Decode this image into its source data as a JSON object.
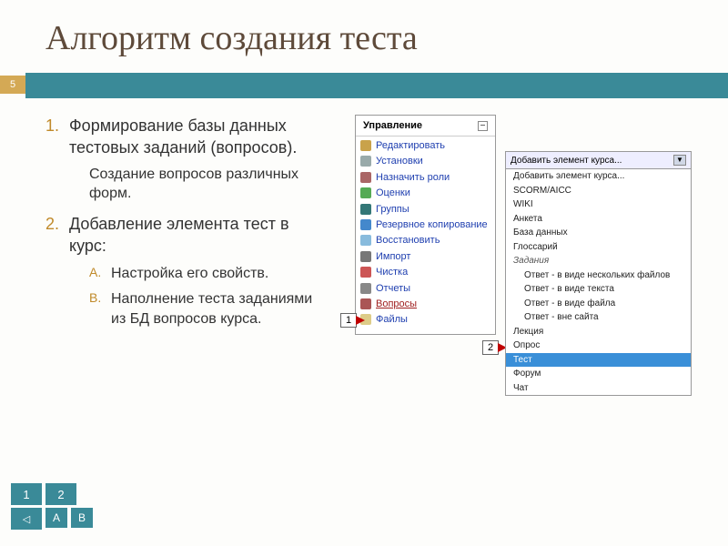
{
  "slide": {
    "title": "Алгоритм создания теста",
    "page_number": "5"
  },
  "outline": {
    "items": [
      {
        "num": "1.",
        "text": "Формирование базы данных тестовых заданий (вопросов).",
        "sub": "Создание вопросов различных форм."
      },
      {
        "num": "2.",
        "text": "Добавление элемента тест в курс:",
        "children": [
          {
            "lit": "A.",
            "text": "Настройка его свойств."
          },
          {
            "lit": "B.",
            "text": "Наполнение теста заданиями из БД вопросов курса."
          }
        ]
      }
    ]
  },
  "admin_panel": {
    "title": "Управление",
    "items": [
      {
        "label": "Редактировать",
        "icon": "#c9a24a"
      },
      {
        "label": "Установки",
        "icon": "#9aa"
      },
      {
        "label": "Назначить роли",
        "icon": "#a66"
      },
      {
        "label": "Оценки",
        "icon": "#5a5"
      },
      {
        "label": "Группы",
        "icon": "#377"
      },
      {
        "label": "Резервное копирование",
        "icon": "#48c"
      },
      {
        "label": "Восстановить",
        "icon": "#8bd"
      },
      {
        "label": "Импорт",
        "icon": "#777"
      },
      {
        "label": "Чистка",
        "icon": "#c55"
      },
      {
        "label": "Отчеты",
        "icon": "#888"
      },
      {
        "label": "Вопросы",
        "icon": "#a55",
        "hl": true
      },
      {
        "label": "Файлы",
        "icon": "#dc8"
      }
    ]
  },
  "dropdown": {
    "header": "Добавить элемент курса...",
    "options": [
      {
        "label": "Добавить элемент курса..."
      },
      {
        "label": "SCORM/AICC"
      },
      {
        "label": "WIKI"
      },
      {
        "label": "Анкета"
      },
      {
        "label": "База данных"
      },
      {
        "label": "Глоссарий"
      },
      {
        "label": "Задания",
        "section": true
      },
      {
        "label": "Ответ - в виде нескольких файлов",
        "indent": true
      },
      {
        "label": "Ответ - в виде текста",
        "indent": true
      },
      {
        "label": "Ответ - в виде файла",
        "indent": true
      },
      {
        "label": "Ответ - вне сайта",
        "indent": true
      },
      {
        "label": "Лекция"
      },
      {
        "label": "Опрос"
      },
      {
        "label": "Тест",
        "selected": true
      },
      {
        "label": "Форум"
      },
      {
        "label": "Чат"
      }
    ]
  },
  "callouts": {
    "one": "1",
    "two": "2"
  },
  "nav": {
    "b1": "1",
    "b2": "2",
    "back": "",
    "a": "A",
    "b": "B"
  }
}
